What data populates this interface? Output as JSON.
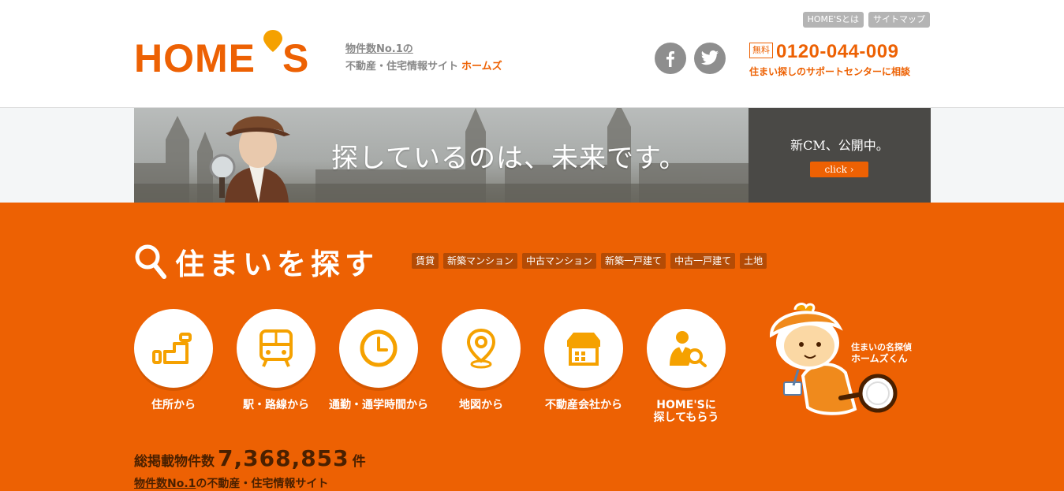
{
  "header": {
    "logo_text": "HOME'S",
    "tagline_line1": "物件数No.1の",
    "tagline_line2": "不動産・住宅情報サイト",
    "tagline_brand": "ホームズ",
    "top_links": [
      "HOME'Sとは",
      "サイトマップ"
    ],
    "phone_badge": "無料",
    "phone_number": "0120-044-009",
    "support_text": "住まい探しのサポートセンターに相談"
  },
  "banner": {
    "copy": "探しているのは、未来です。",
    "cm_title": "新CM、公開中。",
    "click_label": "click ›"
  },
  "search": {
    "title": "住まいを探す",
    "tags": [
      "賃貸",
      "新築マンション",
      "中古マンション",
      "新築一戸建て",
      "中古一戸建て",
      "土地"
    ],
    "methods": [
      {
        "label": "住所から",
        "icon": "address-icon"
      },
      {
        "label": "駅・路線から",
        "icon": "train-icon"
      },
      {
        "label": "通勤・通学時間から",
        "icon": "clock-icon"
      },
      {
        "label": "地図から",
        "icon": "map-pin-icon"
      },
      {
        "label": "不動産会社から",
        "icon": "shop-icon"
      },
      {
        "label_line1": "HOME'Sに",
        "label_line2": "探してもらう",
        "icon": "person-search-icon"
      }
    ],
    "mascot_line1": "住まいの名探偵",
    "mascot_line2": "ホームズくん",
    "count_label": "総掲載物件数",
    "count_value": "7,368,853",
    "count_unit": "件",
    "sub_prefix": "物件数No.1",
    "sub_suffix": "の不動産・住宅情報サイト"
  },
  "colors": {
    "brand_orange": "#ed6103",
    "accent_yellow": "#f5a100",
    "dark_tag": "#b44b05"
  }
}
